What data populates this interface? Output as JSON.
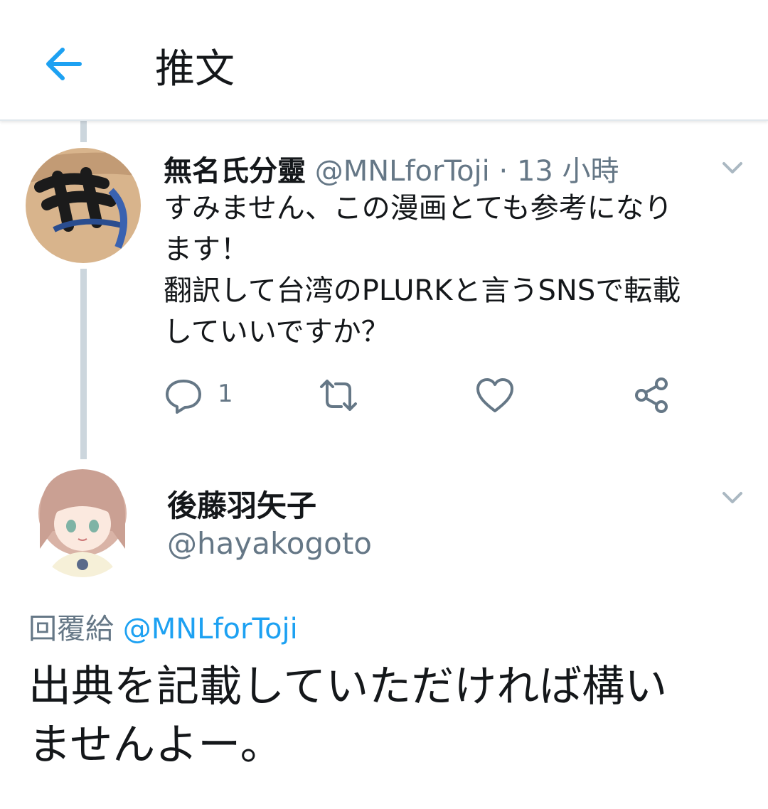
{
  "header": {
    "title": "推文",
    "back_icon": "arrow-left-icon"
  },
  "parent_tweet": {
    "display_name": "無名氏分靈",
    "handle": "@MNLforToji",
    "separator": "·",
    "time": "13 小時",
    "text_lines": [
      "すみません、この漫画とても参考になり",
      "ます！",
      "翻訳して台湾のPLURKと言うSNSで転載",
      "していいですか？"
    ],
    "reply_count": "1",
    "icons": [
      "reply-icon",
      "retweet-icon",
      "like-icon",
      "share-icon",
      "chevron-down-icon"
    ]
  },
  "reply_tweet": {
    "display_name": "後藤羽矢子",
    "handle": "@hayakogoto",
    "reply_to_label": "回覆給",
    "reply_to_handle": "@MNLforToji",
    "text_lines": [
      "出典を記載していただければ構い",
      "ませんよー。"
    ]
  },
  "colors": {
    "accent": "#1da1f2",
    "text": "#14171a",
    "secondary": "#657786",
    "thread_line": "#ccd6dd"
  }
}
